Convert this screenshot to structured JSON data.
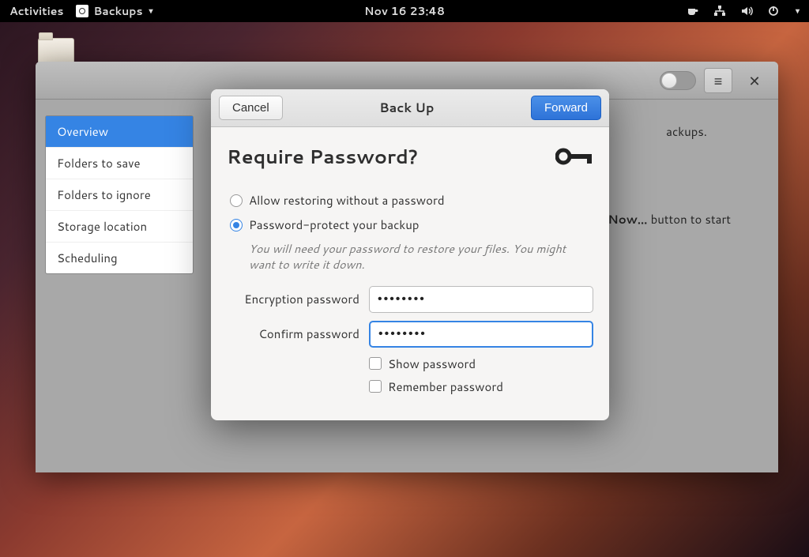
{
  "topbar": {
    "activities": "Activities",
    "app_name": "Backups",
    "datetime": "Nov 16  23:48"
  },
  "main_window": {
    "sidebar": [
      {
        "label": "Overview",
        "active": true
      },
      {
        "label": "Folders to save",
        "active": false
      },
      {
        "label": "Folders to ignore",
        "active": false
      },
      {
        "label": "Storage location",
        "active": false
      },
      {
        "label": "Scheduling",
        "active": false
      }
    ],
    "content_line1_suffix": "ackups.",
    "content_line2_prefix": "Now…",
    "content_line2_rest": " button to start"
  },
  "dialog": {
    "cancel": "Cancel",
    "title": "Back Up",
    "forward": "Forward",
    "heading": "Require Password?",
    "radio_allow": "Allow restoring without a password",
    "radio_protect": "Password-protect your backup",
    "hint": "You will need your password to restore your files. You might want to write it down.",
    "enc_label": "Encryption password",
    "conf_label": "Confirm password",
    "enc_value": "••••••••",
    "conf_value": "••••••••",
    "show_pw": "Show password",
    "remember_pw": "Remember password"
  }
}
